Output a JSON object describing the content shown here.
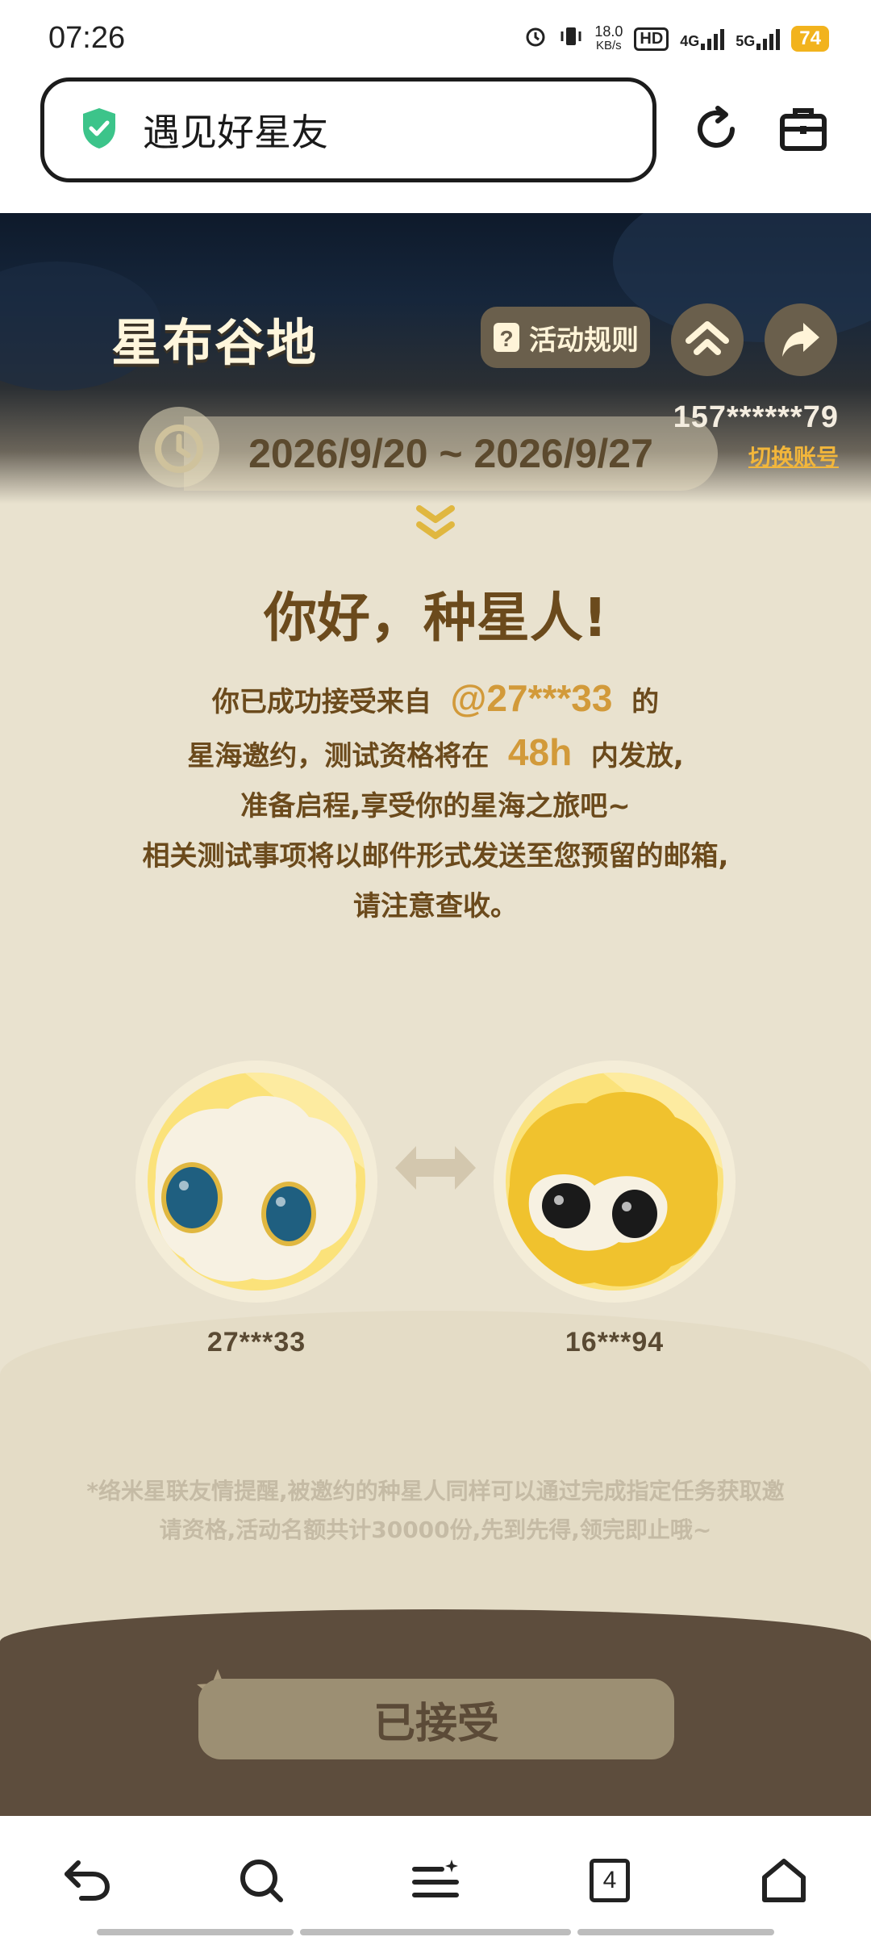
{
  "status_bar": {
    "time": "07:26",
    "net_speed_top": "18.0",
    "net_speed_unit": "KB/s",
    "hd_badge": "HD",
    "network_4g": "4G",
    "network_5g": "5G",
    "battery": "74"
  },
  "browser": {
    "page_title": "遇见好星友"
  },
  "hero": {
    "logo_text": "星布谷地",
    "rules_label": "活动规则",
    "date_range": "2026/9/20 ~ 2026/9/27",
    "account_id": "157******79",
    "switch_account": "切换账号"
  },
  "content": {
    "greeting": "你好，种星人!",
    "line1_pre": "你已成功接受来自",
    "inviter_handle": "@27***33",
    "line1_post": "的",
    "line2_pre": "星海邀约，测试资格将在",
    "hours": "48h",
    "line2_post": "内发放,",
    "line3": "准备启程,享受你的星海之旅吧~",
    "line4": "相关测试事项将以邮件形式发送至您预留的邮箱,",
    "line5": "请注意查收。",
    "inviter_id": "27***33",
    "invitee_id": "16***94",
    "note": "*络米星联友情提醒,被邀约的种星人同样可以通过完成指定任务获取邀请资格,活动名额共计30000份,先到先得,领完即止哦~"
  },
  "action": {
    "accepted_label": "已接受"
  },
  "nav": {
    "tab_count": "4"
  },
  "colors": {
    "accent": "#d29a3a",
    "text_brown": "#6b4a1c",
    "page_bg": "#e9e2cf",
    "panel_brown": "#5d4d3d",
    "shield_green": "#3cc48a"
  }
}
